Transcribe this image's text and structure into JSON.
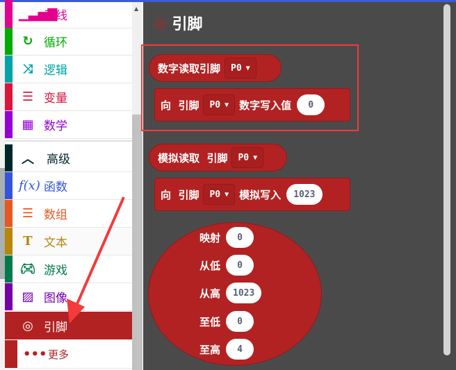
{
  "sidebar": {
    "items": [
      {
        "label": "无线",
        "icon": "signal-icon",
        "color": "#e3008c"
      },
      {
        "label": "循环",
        "icon": "loop-icon",
        "color": "#00aa00"
      },
      {
        "label": "逻辑",
        "icon": "shuffle-icon",
        "color": "#00a4a6"
      },
      {
        "label": "变量",
        "icon": "list-icon",
        "color": "#dc143c"
      },
      {
        "label": "数学",
        "icon": "calculator-icon",
        "color": "#9400d3"
      },
      {
        "label": "高级",
        "icon": "chevron-up-icon",
        "color": "#00272b"
      },
      {
        "label": "函数",
        "icon": "function-icon",
        "color": "#3455db"
      },
      {
        "label": "数组",
        "icon": "numbered-list-icon",
        "color": "#e65722"
      },
      {
        "label": "文本",
        "icon": "text-icon",
        "color": "#b8860b"
      },
      {
        "label": "游戏",
        "icon": "gamepad-icon",
        "color": "#007a4b"
      },
      {
        "label": "图像",
        "icon": "image-icon",
        "color": "#7600a8"
      },
      {
        "label": "引脚",
        "icon": "pin-icon",
        "color": "#b22222"
      },
      {
        "label": "更多",
        "icon": "more-icon",
        "color": "#b22222"
      }
    ]
  },
  "flyout": {
    "title": "引脚",
    "digital_read": {
      "label": "数字读取引脚",
      "pin": "P0"
    },
    "digital_write": {
      "to": "向",
      "pin_label": "引脚",
      "pin": "P0",
      "label": "数字写入值",
      "value": "0"
    },
    "analog_read": {
      "label": "模拟读取",
      "pin_label": "引脚",
      "pin": "P0"
    },
    "analog_write": {
      "to": "向",
      "pin_label": "引脚",
      "pin": "P0",
      "label": "模拟写入",
      "value": "1023"
    },
    "map": [
      {
        "label": "映射",
        "value": "0"
      },
      {
        "label": "从低",
        "value": "0"
      },
      {
        "label": "从高",
        "value": "1023"
      },
      {
        "label": "至低",
        "value": "0"
      },
      {
        "label": "至高",
        "value": "4"
      }
    ]
  }
}
